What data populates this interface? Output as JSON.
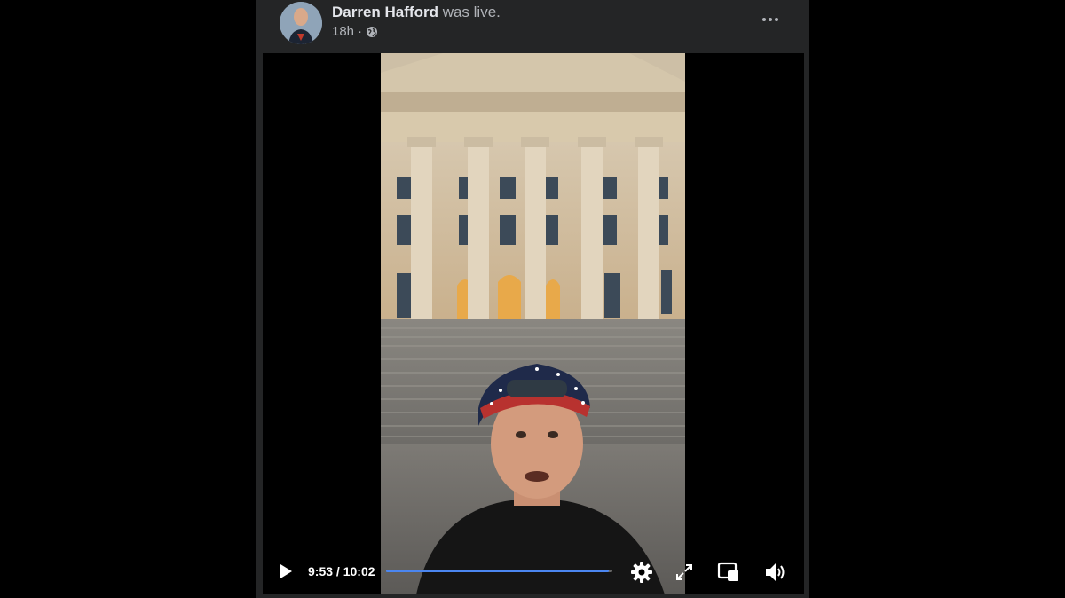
{
  "post": {
    "author": "Darren Hafford",
    "status_text": "was live.",
    "timestamp": "18h",
    "separator": "·",
    "audience_icon": "globe-icon"
  },
  "video": {
    "current_time": "9:53",
    "time_separator": "/",
    "duration": "10:02",
    "progress": 0.985,
    "accent_color": "#4b86f0"
  },
  "controls": {
    "play_icon": "play-icon",
    "settings_icon": "gear-icon",
    "fullscreen_icon": "expand-icon",
    "pip_icon": "picture-in-picture-icon",
    "volume_icon": "volume-icon"
  }
}
